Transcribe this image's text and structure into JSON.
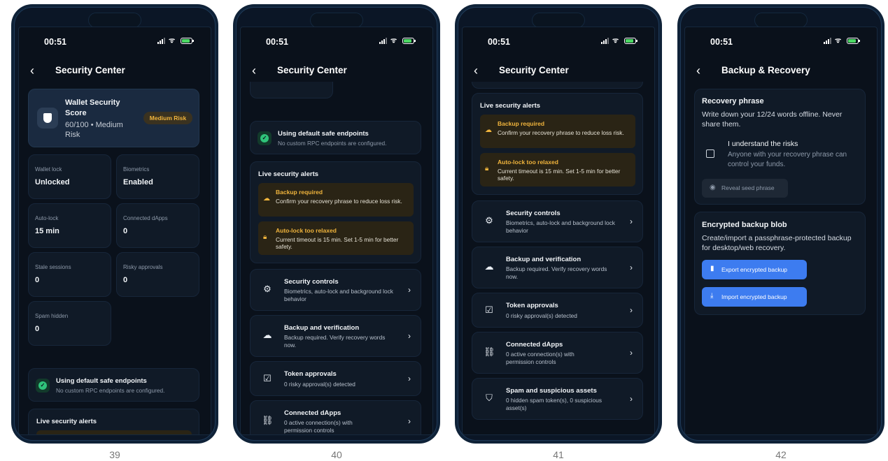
{
  "status": {
    "time": "00:51"
  },
  "captions": [
    "39",
    "40",
    "41",
    "42"
  ],
  "screen39": {
    "title": "Security Center",
    "score_title": "Wallet Security Score",
    "score_value": "60/100 • Medium Risk",
    "risk_badge": "Medium Risk",
    "tiles": [
      {
        "label": "Wallet lock",
        "value": "Unlocked"
      },
      {
        "label": "Biometrics",
        "value": "Enabled"
      },
      {
        "label": "Auto-lock",
        "value": "15 min"
      },
      {
        "label": "Connected dApps",
        "value": "0"
      },
      {
        "label": "Stale sessions",
        "value": "0"
      },
      {
        "label": "Risky approvals",
        "value": "0"
      },
      {
        "label": "Spam hidden",
        "value": "0"
      }
    ],
    "endpoint_title": "Using default safe endpoints",
    "endpoint_sub": "No custom RPC endpoints are configured.",
    "alerts_title": "Live security alerts"
  },
  "screen40": {
    "title": "Security Center",
    "endpoint_title": "Using default safe endpoints",
    "endpoint_sub": "No custom RPC endpoints are configured.",
    "alerts_title": "Live security alerts",
    "alerts": [
      {
        "title": "Backup required",
        "body": "Confirm your recovery phrase to reduce loss risk."
      },
      {
        "title": "Auto-lock too relaxed",
        "body": "Current timeout is 15 min. Set 1-5 min for better safety."
      }
    ],
    "rows": [
      {
        "title": "Security controls",
        "sub": "Biometrics, auto-lock and background lock behavior"
      },
      {
        "title": "Backup and verification",
        "sub": "Backup required. Verify recovery words now."
      },
      {
        "title": "Token approvals",
        "sub": "0 risky approval(s) detected"
      },
      {
        "title": "Connected dApps",
        "sub": "0 active connection(s) with permission controls"
      }
    ]
  },
  "screen41": {
    "title": "Security Center",
    "alerts_title": "Live security alerts",
    "alerts": [
      {
        "title": "Backup required",
        "body": "Confirm your recovery phrase to reduce loss risk."
      },
      {
        "title": "Auto-lock too relaxed",
        "body": "Current timeout is 15 min. Set 1-5 min for better safety."
      }
    ],
    "rows": [
      {
        "title": "Security controls",
        "sub": "Biometrics, auto-lock and background lock behavior"
      },
      {
        "title": "Backup and verification",
        "sub": "Backup required. Verify recovery words now."
      },
      {
        "title": "Token approvals",
        "sub": "0 risky approval(s) detected"
      },
      {
        "title": "Connected dApps",
        "sub": "0 active connection(s) with permission controls"
      },
      {
        "title": "Spam and suspicious assets",
        "sub": "0 hidden spam token(s), 0 suspicious asset(s)"
      }
    ]
  },
  "screen42": {
    "title": "Backup & Recovery",
    "recovery_title": "Recovery phrase",
    "recovery_desc": "Write down your 12/24 words offline. Never share them.",
    "risk_check_title": "I understand the risks",
    "risk_check_sub": "Anyone with your recovery phrase can control your funds.",
    "reveal_label": "Reveal seed phrase",
    "blob_title": "Encrypted backup blob",
    "blob_desc": "Create/import a passphrase-protected backup for desktop/web recovery.",
    "export_label": "Export encrypted backup",
    "import_label": "Import encrypted backup"
  },
  "colors": {
    "accent": "#3d7cf0",
    "warning": "#f0b43c",
    "success": "#2fc47a",
    "background": "#0a111b"
  }
}
